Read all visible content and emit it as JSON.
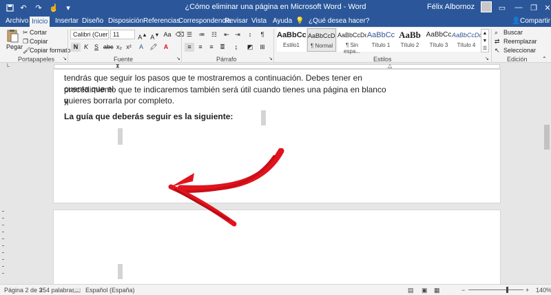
{
  "window": {
    "title": "¿Cómo eliminar una página en Microsoft Word  -  Word",
    "user_name": "Félix Albornoz",
    "share_label": "Compartir"
  },
  "tabs": [
    {
      "label": "Archivo"
    },
    {
      "label": "Inicio"
    },
    {
      "label": "Insertar"
    },
    {
      "label": "Diseño"
    },
    {
      "label": "Disposición"
    },
    {
      "label": "Referencias"
    },
    {
      "label": "Correspondencia"
    },
    {
      "label": "Revisar"
    },
    {
      "label": "Vista"
    },
    {
      "label": "Ayuda"
    },
    {
      "label": "¿Qué desea hacer?"
    }
  ],
  "clipboard": {
    "paste_label": "Pegar",
    "cut_label": "Cortar",
    "copy_label": "Copiar",
    "format_painter_label": "Copiar formato",
    "group_label": "Portapapeles"
  },
  "font": {
    "family_value": "Calibri (Cuer",
    "size_value": "11",
    "group_label": "Fuente",
    "bold_label": "N",
    "italic_label": "K",
    "underline_label": "S"
  },
  "paragraph": {
    "group_label": "Párrafo"
  },
  "styles": {
    "group_label": "Estilos",
    "items": [
      {
        "sample": "AaBbCc",
        "name": "Estilo1"
      },
      {
        "sample": "AaBbCcDc",
        "name": "¶ Normal"
      },
      {
        "sample": "AaBbCcDc",
        "name": "¶ Sin espa..."
      },
      {
        "sample": "AaBbCc",
        "name": "Título 1"
      },
      {
        "sample": "AaBb",
        "name": "Título 2"
      },
      {
        "sample": "AaBbCc",
        "name": "Título 3"
      },
      {
        "sample": "AaBbCcDc",
        "name": "Título 4"
      }
    ]
  },
  "editing": {
    "find_label": "Buscar",
    "replace_label": "Reemplazar",
    "select_label": "Seleccionar",
    "group_label": "Edición"
  },
  "document": {
    "page1_lines": [
      "tendrás que seguir los pasos que te mostraremos a continuación. Debes tener en cuenta que el",
      "procedimiento que te indicaremos también será útil cuando tienes una página en blanco y",
      "quieres borrarla por completo."
    ],
    "page1_bold": "La guía que deberás seguir es la siguiente:"
  },
  "status": {
    "page": "Página 2 de 3",
    "words": "254 palabras",
    "language": "Español (España)",
    "zoom": "140%"
  },
  "colors": {
    "accent": "#2b579a",
    "arrow": "#e0141e"
  },
  "icons": [
    "save-icon",
    "undo-icon",
    "redo-icon",
    "touch-icon",
    "search-icon",
    "lightbulb-icon",
    "share-icon"
  ]
}
